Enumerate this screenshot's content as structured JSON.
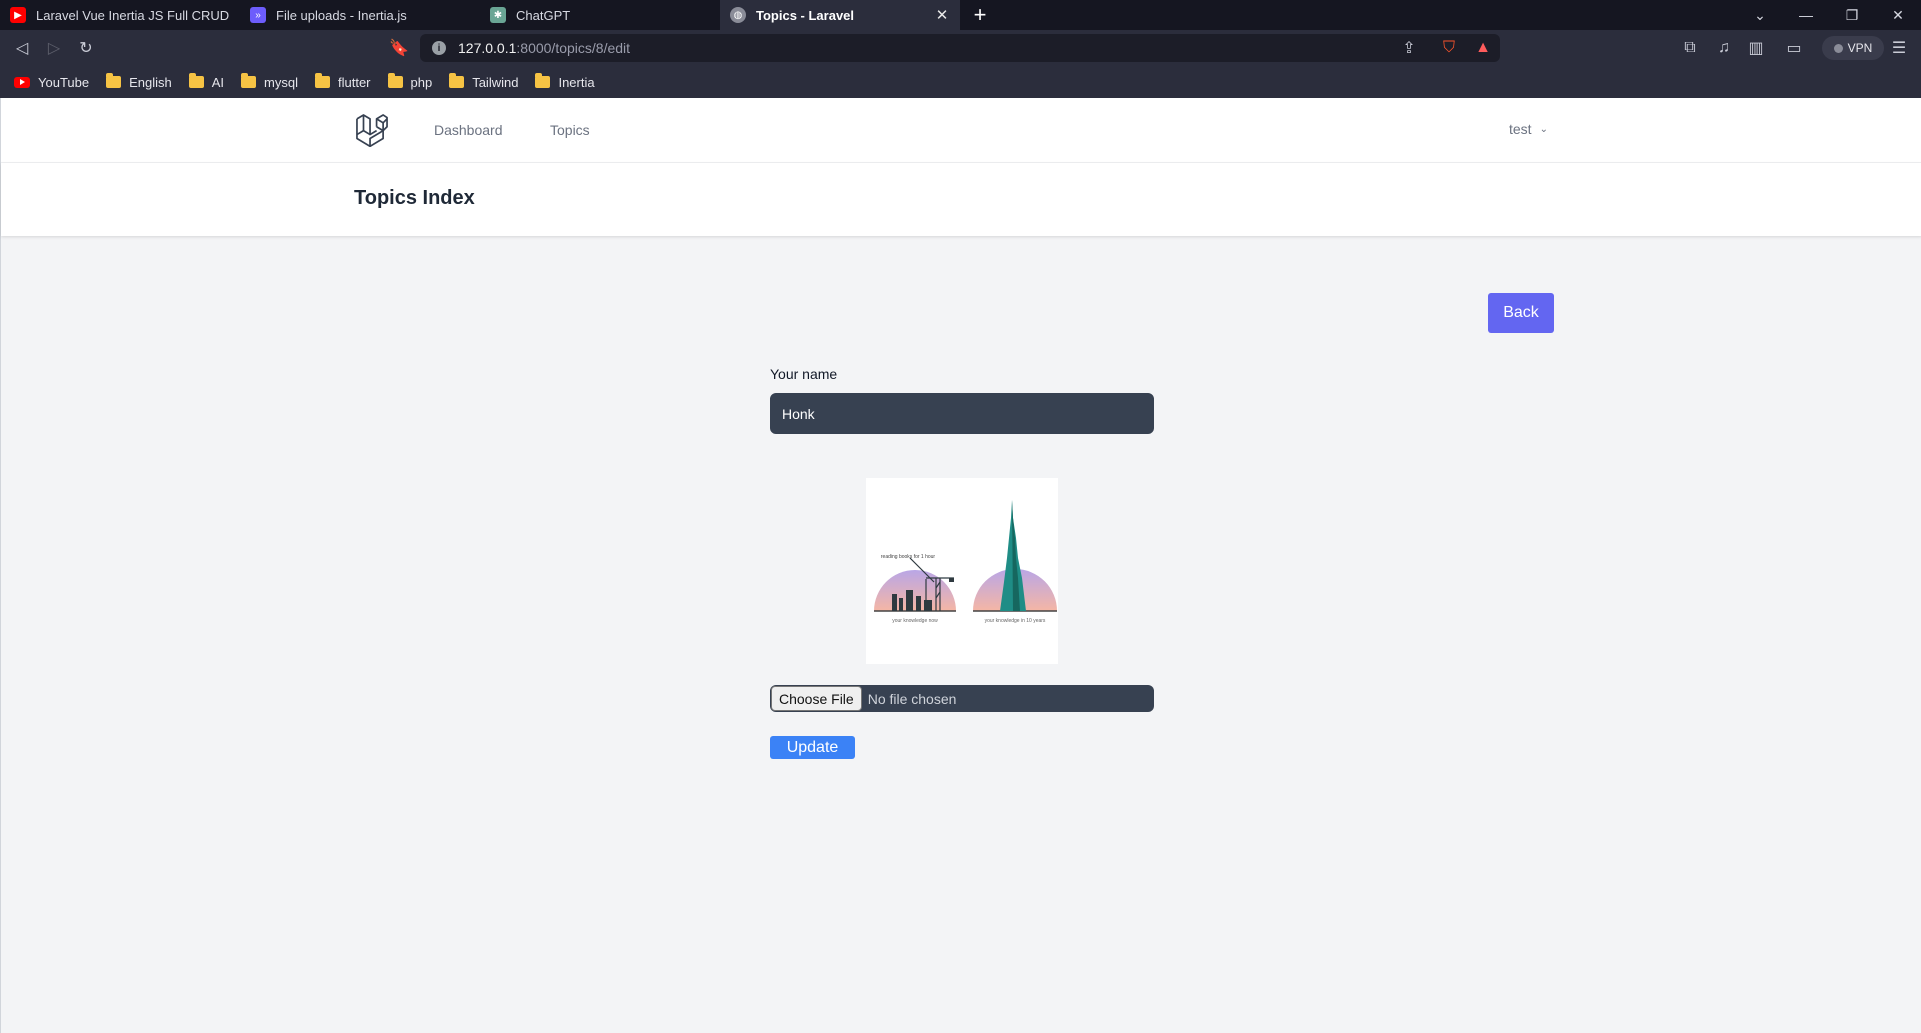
{
  "browser": {
    "tabs": [
      {
        "title": "Laravel Vue Inertia JS Full CRUD Applic",
        "icon": "youtube-icon"
      },
      {
        "title": "File uploads - Inertia.js",
        "icon": "inertia-icon"
      },
      {
        "title": "ChatGPT",
        "icon": "chatgpt-icon"
      },
      {
        "title": "Topics - Laravel",
        "icon": "globe-icon",
        "active": true
      }
    ],
    "url": {
      "host": "127.0.0.1",
      "path": ":8000/topics/8/edit"
    },
    "vpn_label": "VPN",
    "shield_badge": "1",
    "bookmarks": [
      {
        "label": "YouTube",
        "icon": "youtube-icon"
      },
      {
        "label": "English",
        "icon": "folder-icon"
      },
      {
        "label": "AI",
        "icon": "folder-icon"
      },
      {
        "label": "mysql",
        "icon": "folder-icon"
      },
      {
        "label": "flutter",
        "icon": "folder-icon"
      },
      {
        "label": "php",
        "icon": "folder-icon"
      },
      {
        "label": "Tailwind",
        "icon": "folder-icon"
      },
      {
        "label": "Inertia",
        "icon": "folder-icon"
      }
    ]
  },
  "app": {
    "nav": {
      "dashboard": "Dashboard",
      "topics": "Topics"
    },
    "user": "test",
    "header_title": "Topics Index",
    "back_label": "Back",
    "form": {
      "name_label": "Your name",
      "name_value": "Honk",
      "image_caption_left_top": "reading books for 1 hour",
      "image_caption_left_bottom": "your knowledge now",
      "image_caption_right_bottom": "your knowledge in 10 years",
      "file_button": "Choose File",
      "file_status": "No file chosen",
      "submit_label": "Update"
    }
  },
  "colors": {
    "accent": "#6366f1",
    "primary": "#3b82f6",
    "input_bg": "#374151"
  }
}
